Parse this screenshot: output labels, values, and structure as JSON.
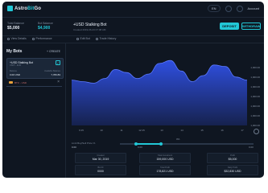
{
  "app": {
    "logo_name": "AstroBitGo",
    "logo_first": "Astro",
    "logo_accent": "Bit",
    "logo_last": "Go",
    "accent": "#22c7d6"
  },
  "top_right": {
    "lang_pill": "EN",
    "bell_icon": "bell-icon",
    "account": "Account"
  },
  "balances": [
    {
      "label": "Total Balance",
      "value": "$5,000"
    },
    {
      "label": "Bot Balance",
      "value": "$4,900",
      "accent": true
    }
  ],
  "bot_header": {
    "title": "+USD Stalking Bot",
    "subtitle": "Created 2019-06-23 07:08 AM"
  },
  "buttons": {
    "deposit": "DEPOSIT",
    "withdraw": "WITHDRAW"
  },
  "nav": [
    "View Details",
    "Performance",
    "Edit Bot",
    "Trade History"
  ],
  "sidebar": {
    "title": "My Bots",
    "create": "+ CREATE",
    "bots": [
      {
        "name": "+USD Stalking Bot",
        "sub": "USDT - EUR",
        "left_label": "Balance",
        "left_value": "0.00 USD",
        "right_label": "Available Balance",
        "right_value": "7,783.83"
      }
    ],
    "secondary": {
      "name": "BTC - USD",
      "close": "×"
    }
  },
  "chart_data": {
    "type": "area",
    "x": [
      "9:15",
      "10",
      "11",
      "12:15",
      "13",
      "14",
      "15",
      "16",
      "17"
    ],
    "y_ticks": [
      "1,000.00",
      "1,000.00",
      "1,000.00",
      "1,000.00",
      "1,000.00",
      "1,000.00",
      "1,000.00"
    ],
    "values": [
      0.6,
      0.58,
      0.56,
      0.62,
      0.74,
      0.7,
      0.62,
      0.68,
      0.82,
      0.86,
      0.72,
      0.58,
      0.66,
      0.8,
      0.78,
      0.64,
      0.6
    ],
    "ylim": [
      0,
      1
    ],
    "fill_top": "#2f4fe0",
    "fill_bottom": "#16224e",
    "line": "#5b79ff"
  },
  "range": {
    "label": "Limit Buy/Sell Price %",
    "value": "0.00",
    "top_value": "0%",
    "tick_left": "0.00",
    "tick_right": "0.00",
    "fill_from": 0.12,
    "fill_to": 0.31
  },
  "stats": [
    {
      "k": "Created",
      "v": "Mar 30, 2019"
    },
    {
      "k": "Total Investment",
      "v": "159,000 USD"
    },
    {
      "k": "Profit",
      "v": "$5,000"
    },
    {
      "k": "Bot ID",
      "v": "0000"
    },
    {
      "k": "Total Profit",
      "v": "178,821 USD"
    },
    {
      "k": "Daily Profit",
      "v": "$32,830 USD"
    }
  ]
}
